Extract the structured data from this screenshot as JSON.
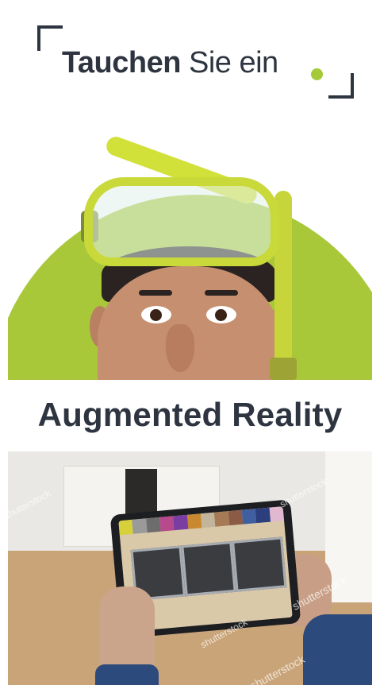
{
  "header": {
    "tagline_bold": "Tauchen",
    "tagline_rest": " Sie ein"
  },
  "banner": {
    "title": "Augmented Reality"
  },
  "photo": {
    "watermarks": [
      "shutterstock",
      "shutterstock",
      "shutterstock",
      "shutterstock",
      "shutterstock"
    ]
  },
  "colors": {
    "accent_green": "#a4c939",
    "text_dark": "#2e3540",
    "swatches": [
      "#d8d03a",
      "#9a9a9a",
      "#6d6d6d",
      "#b74a8c",
      "#7a3da1",
      "#c9892f",
      "#c2b59c",
      "#a67a55",
      "#8b5b45",
      "#3f5fa0",
      "#2b3e7e",
      "#e0b8cf"
    ]
  }
}
